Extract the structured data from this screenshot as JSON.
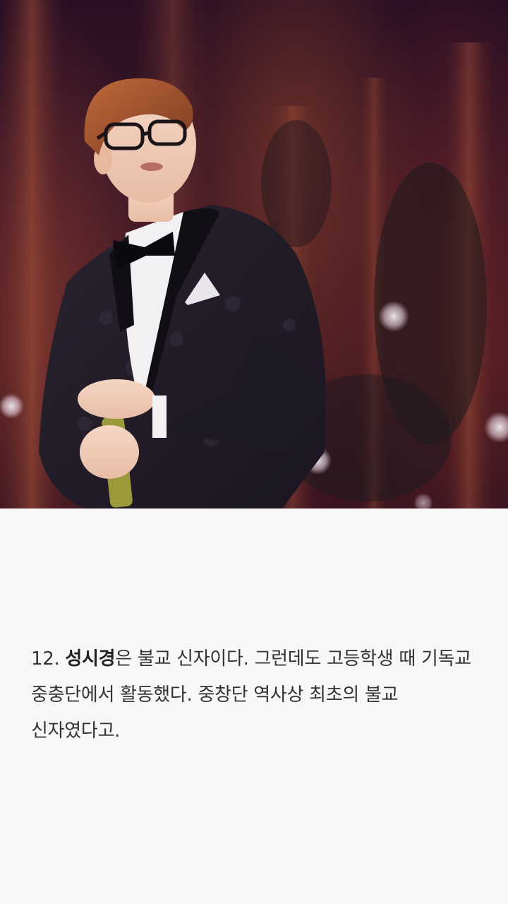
{
  "photo": {
    "subject": "man in black tuxedo with bow tie and glasses holding a microphone on stage"
  },
  "caption": {
    "number": "12.",
    "name": "성시경",
    "text": "은 불교 신자이다. 그런데도 고등학생 때 기독교 중충단에서 활동했다. 중창단 역사상 최초의 불교 신자였다고."
  }
}
